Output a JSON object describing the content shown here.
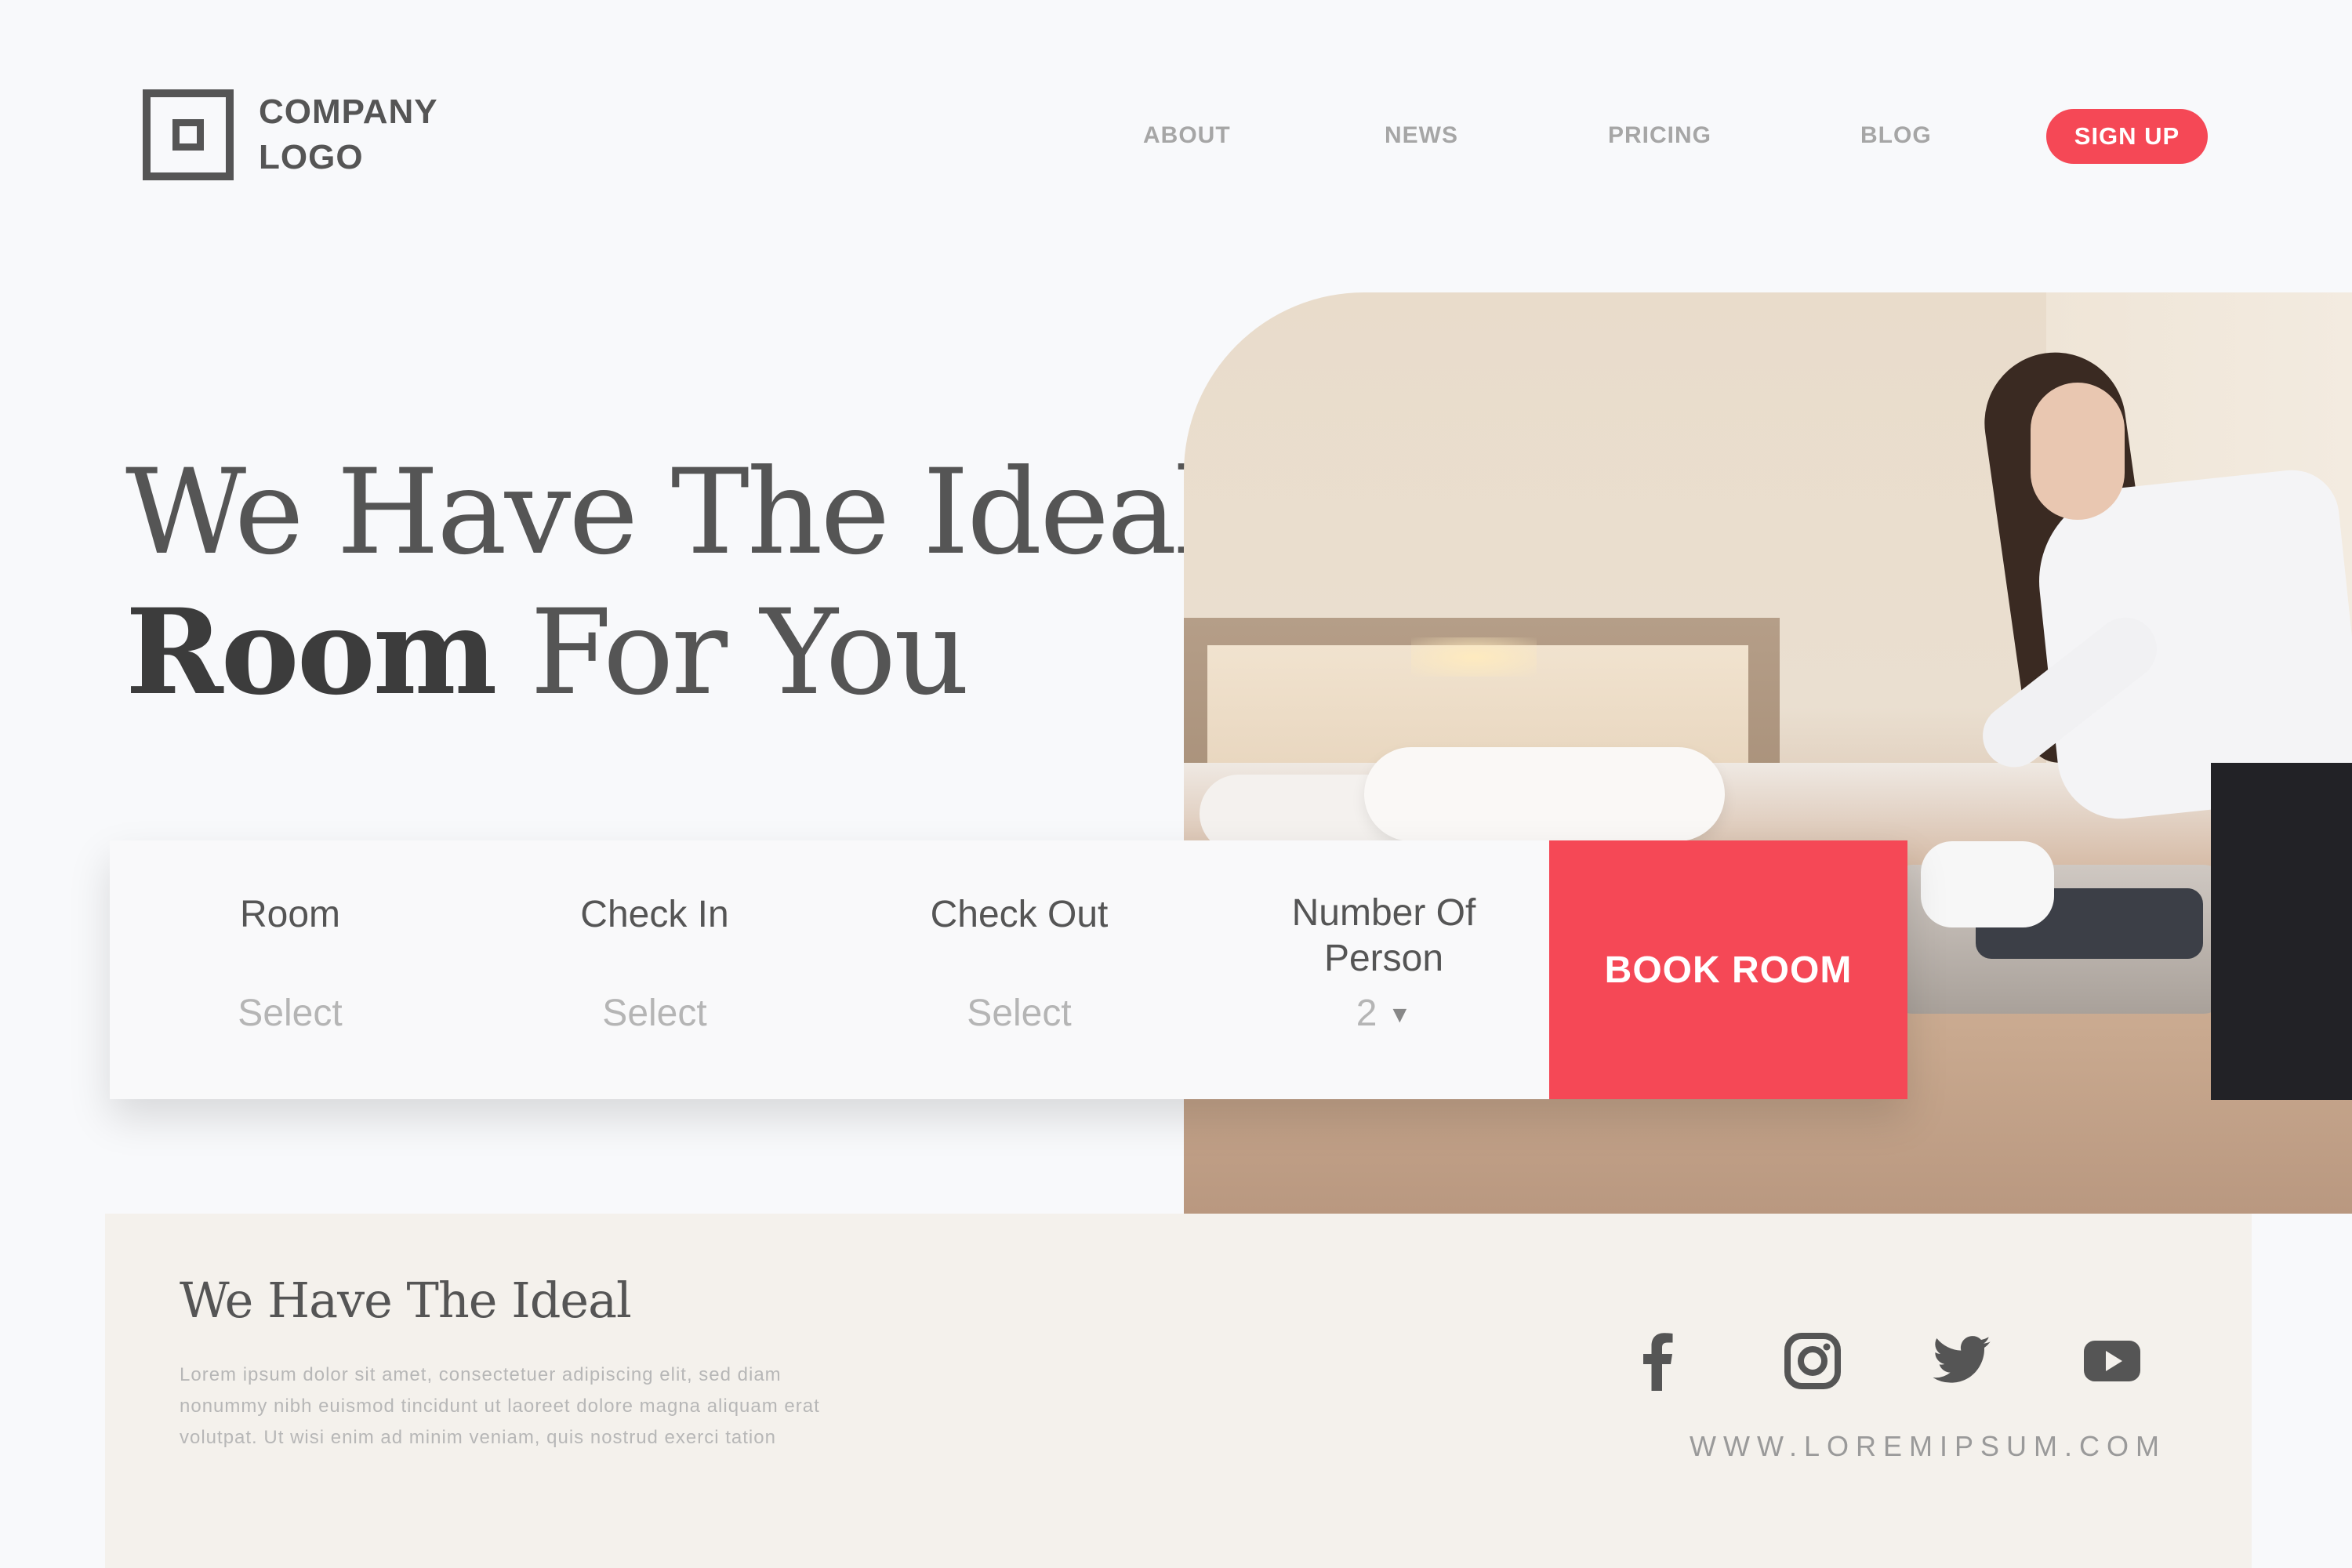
{
  "header": {
    "logo_line1": "COMPANY",
    "logo_line2": "LOGO",
    "nav": [
      "ABOUT",
      "NEWS",
      "PRICING",
      "BLOG"
    ],
    "signup_label": "SIGN UP"
  },
  "hero": {
    "title_line1": "We Have The Ideal",
    "title_line2_bold": "Room",
    "title_line2_rest": "For You"
  },
  "booking": {
    "fields": [
      {
        "label": "Room",
        "value": "Select"
      },
      {
        "label": "Check In",
        "value": "Select"
      },
      {
        "label": "Check Out",
        "value": "Select"
      },
      {
        "label_line1": "Number Of",
        "label_line2": "Person",
        "value": "2"
      }
    ],
    "button_label": "BOOK ROOM"
  },
  "footer": {
    "title": "We Have The Ideal",
    "body": "Lorem ipsum dolor sit amet, consectetuer adipiscing elit, sed diam nonummy nibh euismod tincidunt ut laoreet dolore magna aliquam erat volutpat. Ut wisi enim ad minim veniam, quis nostrud exerci tation",
    "social_icons": [
      "facebook-icon",
      "instagram-icon",
      "twitter-icon",
      "youtube-icon"
    ],
    "url": "WWW.LOREMIPSUM.COM"
  },
  "colors": {
    "accent": "#f54856",
    "text": "#555555",
    "page_bg": "#f8f9fb",
    "footer_bg": "#f4f1ec"
  }
}
